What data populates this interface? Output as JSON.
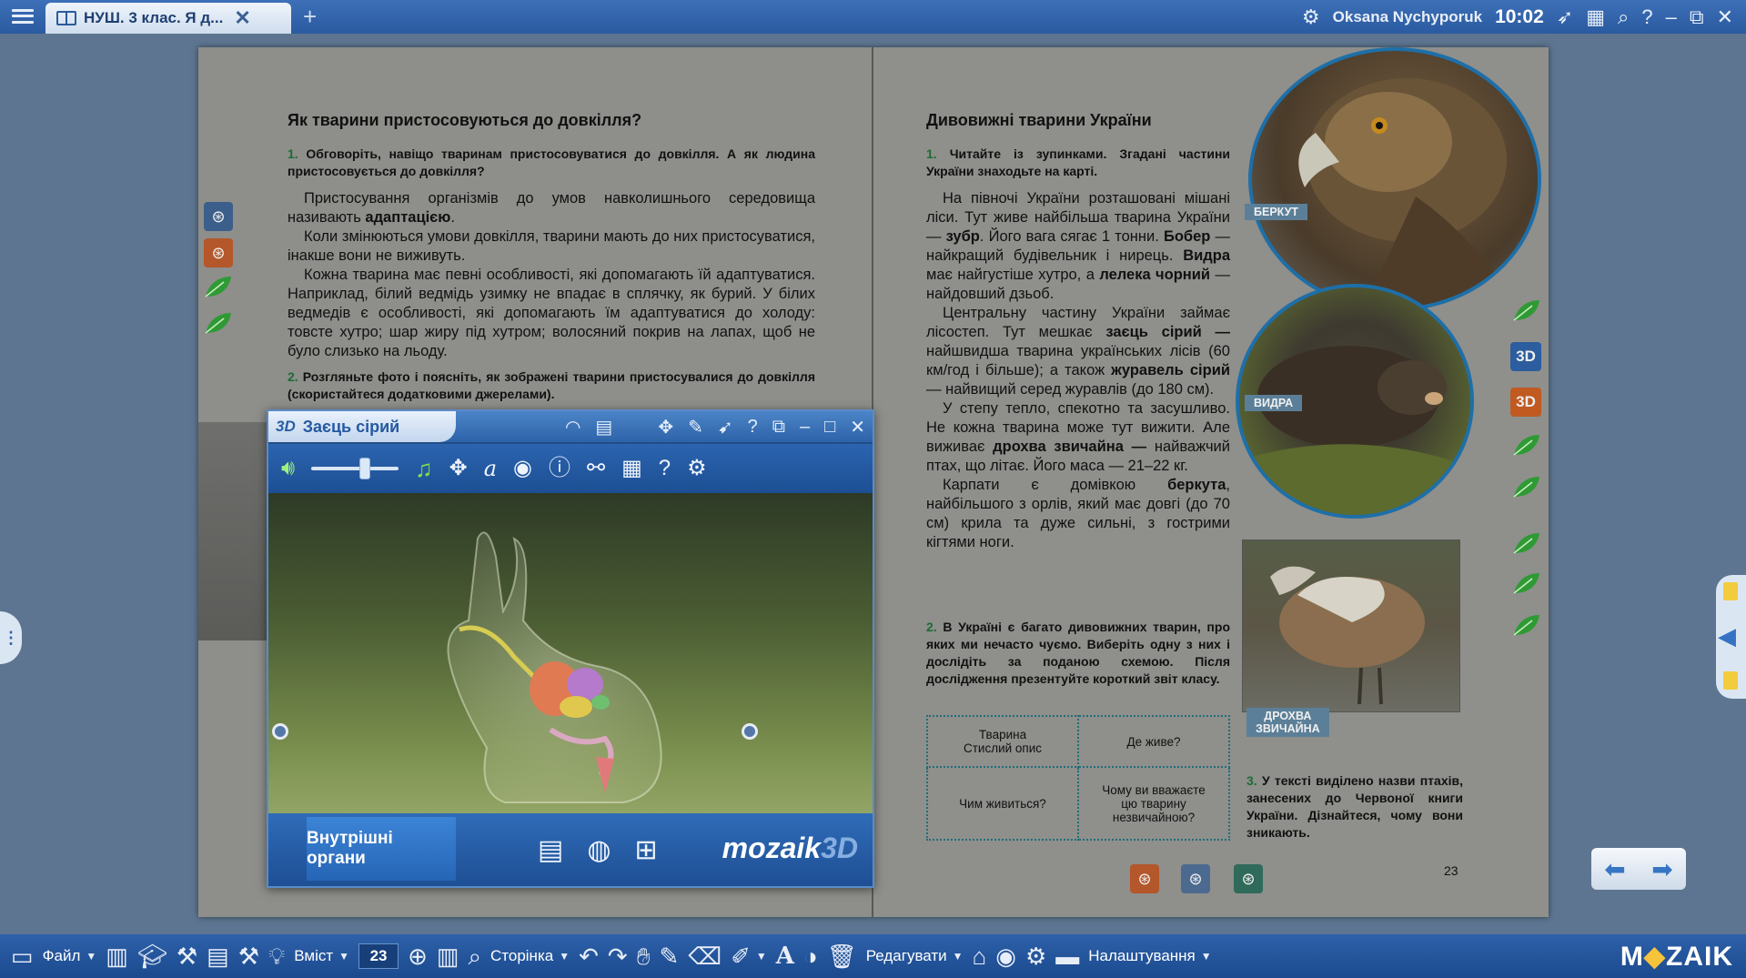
{
  "topbar": {
    "tab_title": "НУШ. 3 клас. Я д...",
    "tab_close": "✕",
    "tab_add": "+",
    "user_name": "Oksana Nychyporuk",
    "time": "10:02"
  },
  "left_page": {
    "heading": "Як тварини пристосовуються до довкілля?",
    "task1_num": "1.",
    "task1_text": "Обговоріть, навіщо тваринам пристосовуватися до довкілля. А як людина пристосовується до довкілля?",
    "p1_a": "Пристосування організмів до умов навколишнього середовища називають ",
    "p1_b": "адаптацією",
    "p1_c": ".",
    "p2": "Коли змінюються умови довкілля, тварини мають до них пристосуватися, інакше вони не виживуть.",
    "p3": "Кожна тварина має певні особливості, які допомагають їй адаптуватися. Наприклад, білий ведмідь узимку не впадає в сплячку, як бурий. У білих ведмедів є особливості, які допомагають їм адаптуватися до холоду: товсте хутро; шар жиру під хутром; волосяний покрив на лапах, щоб не було слизько на льоду.",
    "task2_num": "2.",
    "task2_text": "Розгляньте фото і поясніть, як зображені тварини пристосувалися до довкілля (скористайтеся додатковими джерелами)."
  },
  "right_page": {
    "heading": "Дивовижні тварини України",
    "task1_num": "1.",
    "task1_text": "Читайте із зупинками. Згадані частини України знаходьте на карті.",
    "p1": [
      {
        "t": "На півночі України розташовані мішані ліси. Тут живе найбільша тварина України — "
      },
      {
        "b": "зубр"
      },
      {
        "t": ". Його вага сягає 1 тонни. "
      },
      {
        "b": "Бобер"
      },
      {
        "t": " — найкращий будівельник і нирець. "
      },
      {
        "b": "Видра"
      },
      {
        "t": " має найгустіше хутро, а "
      },
      {
        "b": "лелека чорний"
      },
      {
        "t": " — найдовший дзьоб."
      }
    ],
    "p2": [
      {
        "t": "Центральну частину України займає лісостеп. Тут мешкає "
      },
      {
        "b": "заєць сірий —"
      },
      {
        "t": " найшвидша тварина українських лісів (60 км/год і більше); а також "
      },
      {
        "b": "журавель сірий"
      },
      {
        "t": " — найвищий серед журавлів (до 180 см)."
      }
    ],
    "p3": [
      {
        "t": "У степу тепло, спекотно та засушливо. Не кожна тварина може тут вижити. Але виживає "
      },
      {
        "b": "дрохва звичайна —"
      },
      {
        "t": " найважчий птах, що літає. Його маса — 21–22 кг."
      }
    ],
    "p4": [
      {
        "t": "Карпати є домівкою "
      },
      {
        "b": "беркута"
      },
      {
        "t": ", найбільшого з орлів, який має довгі (до 70 см) крила та дуже сильні, з гострими кігтями ноги."
      }
    ],
    "task2_num": "2.",
    "task2_text": "В Україні є багато дивовижних тварин, про яких ми нечасто чуємо. Виберіть одну з них і дослідіть за поданою схемою. Після дослідження презентуйте короткий звіт класу.",
    "table": {
      "r1c1a": "Тварина",
      "r1c1b": "Стислий опис",
      "r1c2": "Де живе?",
      "r2c1": "Чим живиться?",
      "r2c2a": "Чому ви вважаєте",
      "r2c2b": "цю тварину",
      "r2c2c": "незвичайною?"
    },
    "task3_num": "3.",
    "task3_text": "У тексті виділено назви птахів, занесених до Червоної книги України. Дізнайтеся, чому вони зникають.",
    "label_eagle": "БЕРКУТ",
    "label_otter": "ВИДРА",
    "label_bustard_1": "ДРОХВА",
    "label_bustard_2": "ЗВИЧАЙНА",
    "page_number": "23"
  },
  "window3d": {
    "badge": "3D",
    "title": "Заєць сірий",
    "volume_fraction": 0.55,
    "organs_button": "Внутрішні органи",
    "brand_a": "mozaik",
    "brand_b": "3D"
  },
  "bottombar": {
    "file": "Файл",
    "content": "Вміст",
    "page_number": "23",
    "page": "Сторінка",
    "edit": "Редагувати",
    "settings": "Налаштування",
    "logo_a": "M",
    "logo_b": "◆",
    "logo_c": "ZAIK"
  },
  "side_icons": {
    "3d_blue": "3D",
    "3d_orange": "3D"
  },
  "colors": {
    "accent_blue": "#2a5aa0",
    "leaf_green": "#2f9a34",
    "task_number_green": "#1c6c33",
    "badge_orange": "#c05a20"
  }
}
